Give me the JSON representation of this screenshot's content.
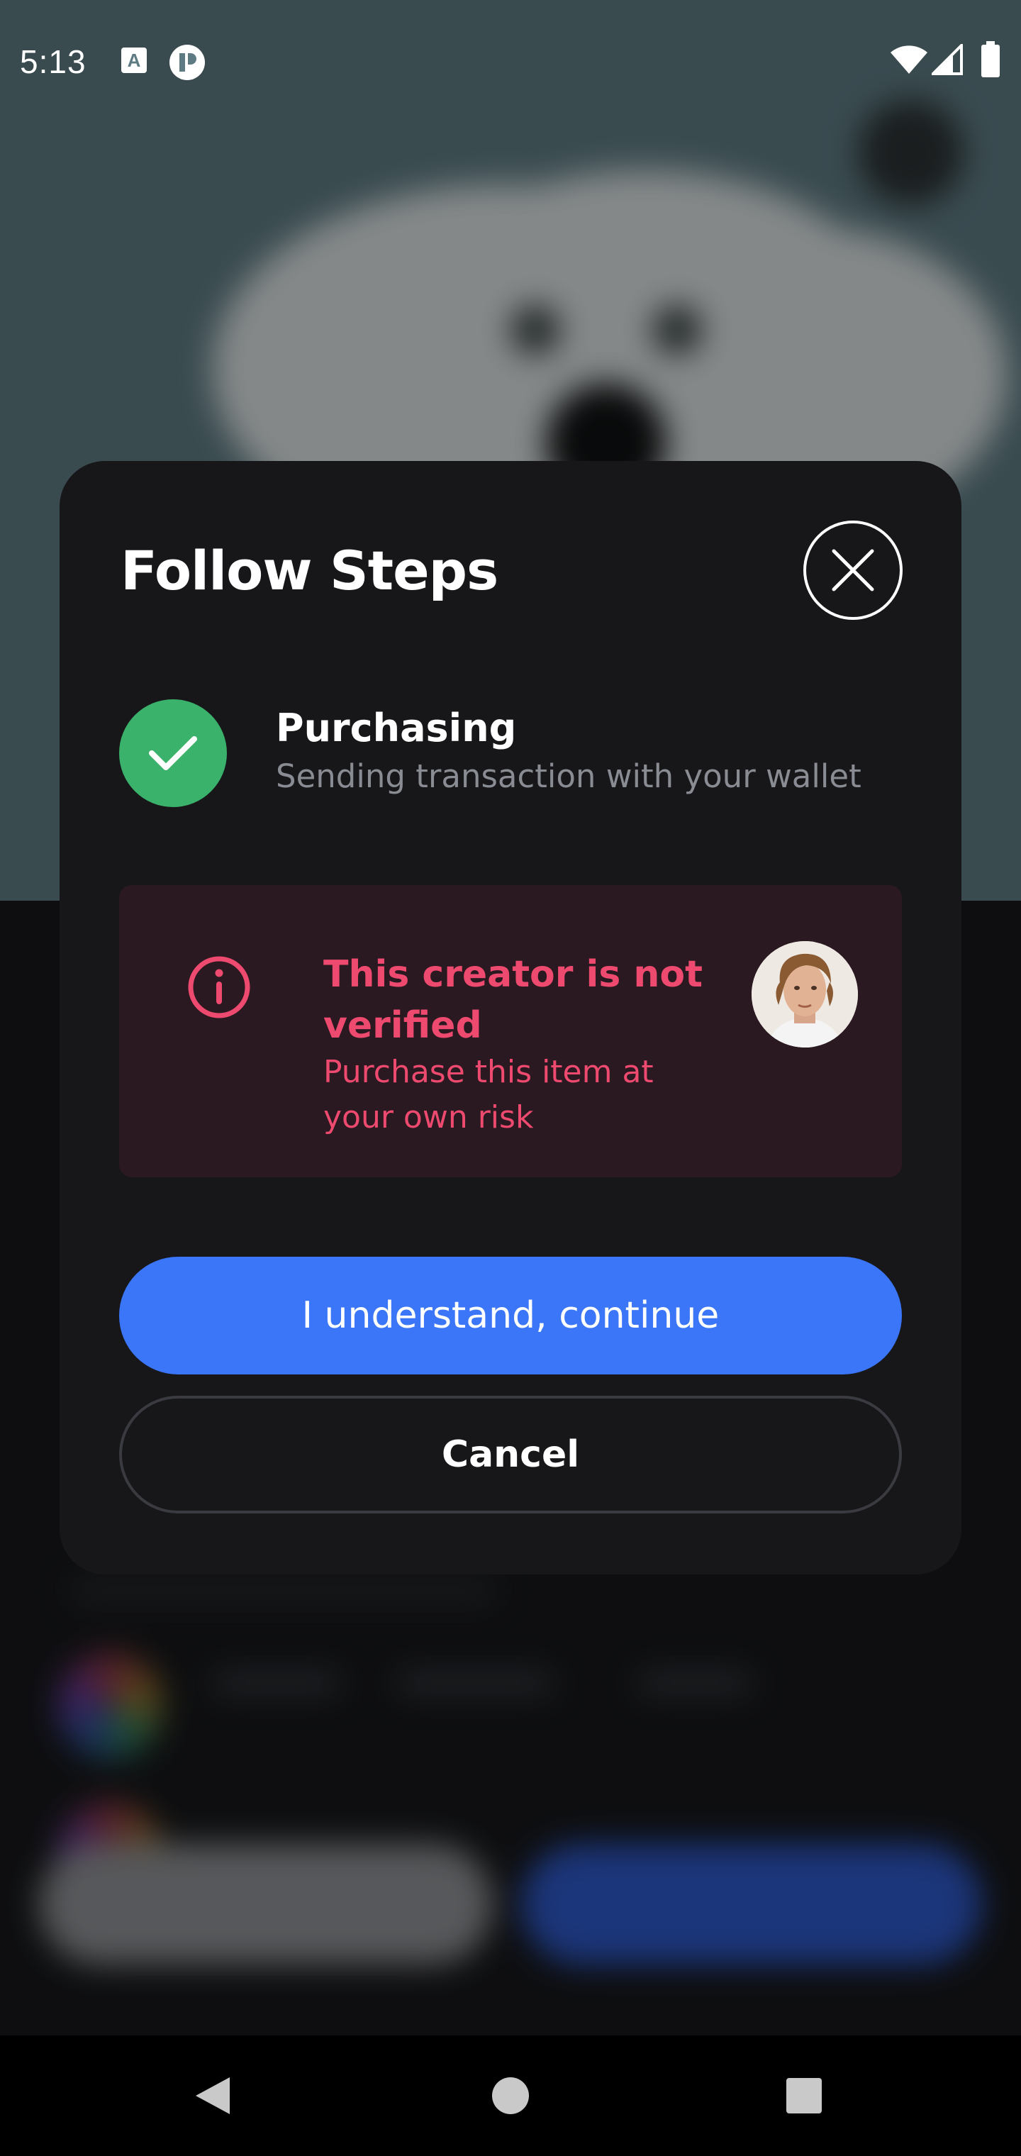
{
  "status_bar": {
    "time": "5:13",
    "icons": [
      "font-a-icon",
      "app-p-icon",
      "wifi-icon",
      "cellular-signal-icon",
      "battery-icon"
    ]
  },
  "modal": {
    "title": "Follow Steps",
    "close_icon": "close-icon",
    "step": {
      "title": "Purchasing",
      "subtitle": "Sending transaction with your wallet",
      "status_icon": "checkmark-icon",
      "status_color": "#3bb26b"
    },
    "warning": {
      "title": "This creator is not verified",
      "subtitle": "Purchase this item at your own risk",
      "icon": "info-icon",
      "color": "#ee4a6f",
      "background": "#2a1920"
    },
    "continue_label": "I understand, continue",
    "cancel_label": "Cancel",
    "accent": "#3a76f7"
  },
  "nav_bar": {
    "back_icon": "back-triangle-icon",
    "home_icon": "home-circle-icon",
    "recents_icon": "recents-square-icon"
  }
}
